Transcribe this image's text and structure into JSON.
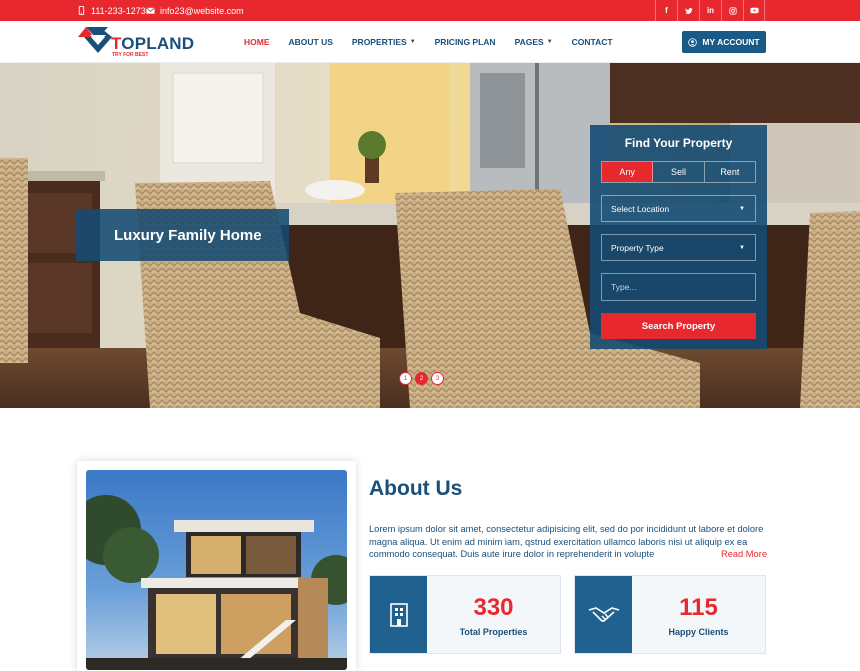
{
  "topbar": {
    "phone": "111-233-1273",
    "email": "info23@website.com",
    "socials": [
      {
        "icon": "facebook-icon",
        "glyph": "f"
      },
      {
        "icon": "twitter-icon",
        "glyph": "t"
      },
      {
        "icon": "linkedin-icon",
        "glyph": "in"
      },
      {
        "icon": "instagram-icon",
        "glyph": "◎"
      },
      {
        "icon": "youtube-icon",
        "glyph": "▶"
      }
    ]
  },
  "brand": {
    "name_first": "T",
    "name_rest": "OPLAND",
    "tagline": "TRY FOR BEST",
    "primary_color": "#e8282f",
    "secondary_color": "#1a4f7a"
  },
  "nav": {
    "items": [
      {
        "label": "HOME",
        "active": true
      },
      {
        "label": "ABOUT US"
      },
      {
        "label": "PROPERTIES",
        "dropdown": true
      },
      {
        "label": "PRICING PLAN"
      },
      {
        "label": "PAGES",
        "dropdown": true
      },
      {
        "label": "CONTACT"
      }
    ],
    "account_label": "MY ACCOUNT"
  },
  "hero": {
    "caption": "Luxury Family Home",
    "slides": [
      "1",
      "2",
      "3"
    ],
    "active_slide": 2
  },
  "search": {
    "title": "Find Your Property",
    "tabs": [
      "Any",
      "Sell",
      "Rent"
    ],
    "active_tab": "Any",
    "location_select": "Select Location",
    "type_select": "Property Type",
    "type_placeholder": "Type...",
    "button": "Search Property"
  },
  "about": {
    "title": "About Us",
    "body": "Lorem ipsum dolor sit amet, consectetur adipisicing elit, sed do por incididunt ut labore et dolore magna aliqua. Ut enim ad minim iam, qstrud exercitation ullamco laboris nisi ut aliquip ex ea commodo consequat. Duis aute irure dolor in reprehenderit in volupte",
    "read_more": "Read More",
    "stats": [
      {
        "value": "330",
        "label": "Total Properties",
        "icon": "building-icon"
      },
      {
        "value": "115",
        "label": "Happy Clients",
        "icon": "handshake-icon"
      }
    ]
  }
}
